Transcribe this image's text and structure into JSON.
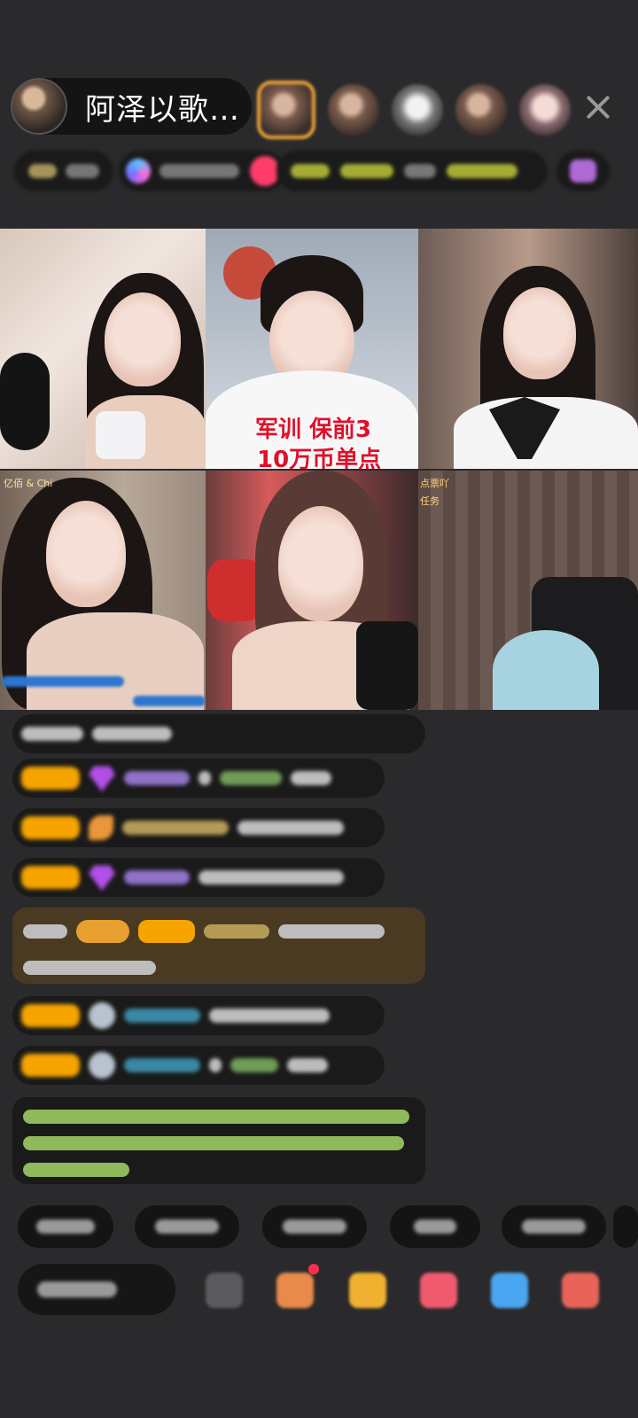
{
  "header": {
    "host_name": "阿泽以歌…",
    "host_avatar_icon": "host-avatar",
    "audience_icons": [
      "viewer-avatar-1",
      "viewer-avatar-2",
      "viewer-avatar-3",
      "viewer-avatar-4",
      "viewer-avatar-5"
    ],
    "close_icon": "close-icon"
  },
  "video_grid": {
    "tile_top_center": {
      "overlay_line1": "军训 保前3",
      "overlay_line2": "10万币单点"
    },
    "tile_bottom_left": {
      "caption": "亿佰 & Chi"
    },
    "tile_bottom_right": {
      "caption_line1": "点票吖",
      "caption_line2": "任务"
    }
  },
  "colors": {
    "background": "#2a2a2c",
    "pill": "#141414",
    "accent_orange": "#f5a400",
    "gift_gold": "#e8a030",
    "overlay_red": "#e0102a"
  }
}
